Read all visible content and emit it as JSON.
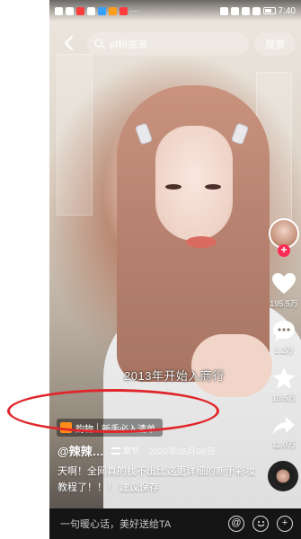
{
  "status_bar": {
    "time": "7:40",
    "more_indicator": "···"
  },
  "search": {
    "query": "pf粉底液",
    "button_label": "搜索"
  },
  "rail": {
    "like_count": "195.5万",
    "comment_count": "1.2万",
    "favorite_count": "19.5万",
    "share_count": "11.0万"
  },
  "video": {
    "caption_overlay": "2013年开始入商行"
  },
  "shop_tag": {
    "label": "购物",
    "sublabel": "新手必入清单"
  },
  "author": {
    "name": "@辣辣…",
    "chapters_label": "章节",
    "date": "2020年05月08日"
  },
  "description": "天啊！全网真的找不出比这更详细的新手彩妆教程了！！！ 建议保存",
  "comment_bar": {
    "placeholder": "一句暖心话，美好送给TA",
    "at_icon": "@",
    "add_icon": "+"
  },
  "colors": {
    "accent": "#fe2c55",
    "highlight_oval": "#e0262b",
    "shop_icon": "#ff8c1a"
  }
}
